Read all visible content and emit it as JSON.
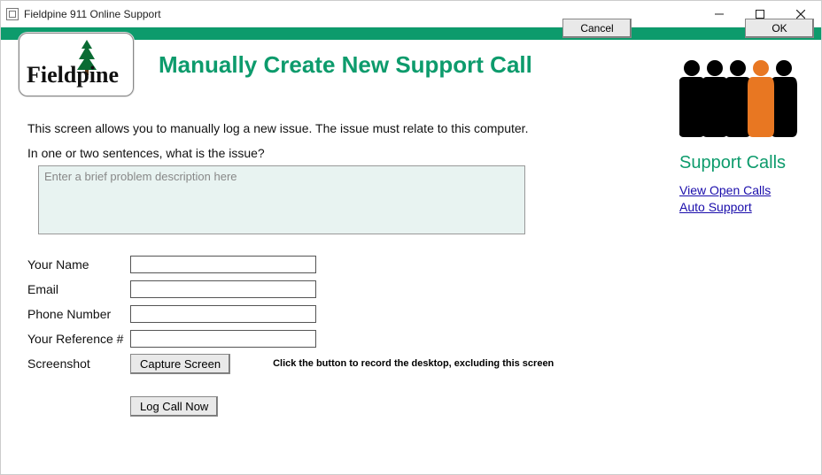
{
  "window": {
    "title": "Fieldpine 911 Online Support"
  },
  "strip": {
    "cancel": "Cancel",
    "ok": "OK"
  },
  "logo_text": "Fieldpine",
  "page_title": "Manually Create New Support Call",
  "intro": "This screen allows you to manually log a new issue. The issue must relate to this computer.",
  "prompt": "In one or two sentences, what is the issue?",
  "description_placeholder": "Enter a brief problem description here",
  "form": {
    "name_label": "Your Name",
    "email_label": "Email",
    "phone_label": "Phone Number",
    "ref_label": "Your Reference #",
    "screenshot_label": "Screenshot",
    "capture_btn": "Capture Screen",
    "capture_note": "Click the button to record the desktop, excluding this screen",
    "submit_btn": "Log Call Now"
  },
  "sidebar": {
    "heading": "Support Calls",
    "links": {
      "open": "View Open Calls",
      "auto": "Auto Support"
    }
  }
}
